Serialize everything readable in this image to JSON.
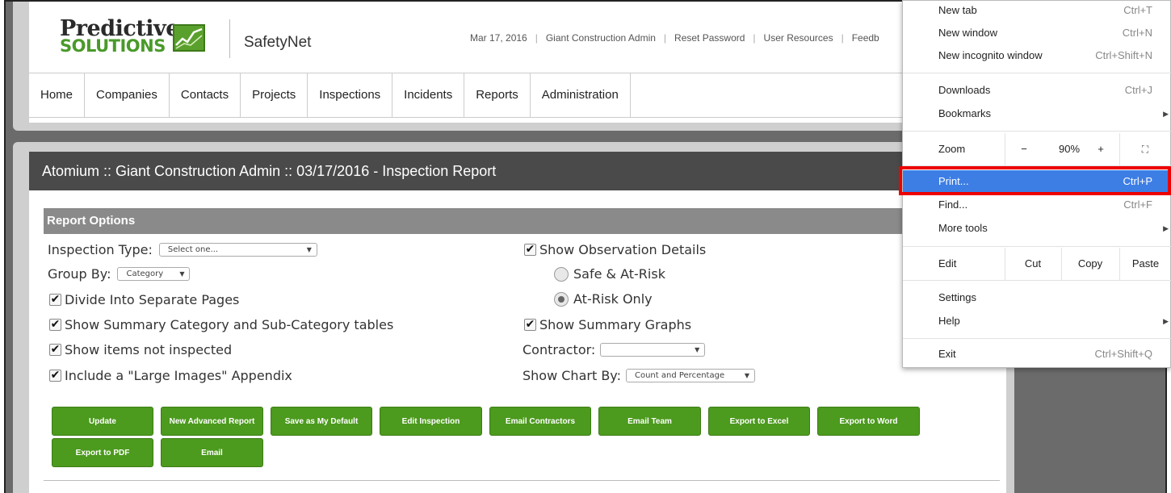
{
  "header": {
    "logo_line1": "Predictive",
    "logo_line2": "SOLUTIONS",
    "app_name": "SafetyNet",
    "links": [
      "Mar 17, 2016",
      "Giant Construction Admin",
      "Reset Password",
      "User Resources",
      "Feedb"
    ]
  },
  "nav": [
    "Home",
    "Companies",
    "Contacts",
    "Projects",
    "Inspections",
    "Incidents",
    "Reports",
    "Administration"
  ],
  "page": {
    "title": "Atomium :: Giant Construction Admin :: 03/17/2016 - Inspection Report",
    "options_header": "Report Options"
  },
  "options": {
    "inspection_type_label": "Inspection Type:",
    "inspection_type_value": "Select one...",
    "group_by_label": "Group By:",
    "group_by_value": "Category",
    "divide_pages": "Divide Into Separate Pages",
    "summary_tables": "Show Summary Category and Sub-Category tables",
    "not_inspected": "Show items not inspected",
    "large_images": "Include a \"Large Images\" Appendix",
    "observation_details": "Show Observation Details",
    "safe_at_risk": "Safe & At-Risk",
    "at_risk_only": "At-Risk Only",
    "summary_graphs": "Show Summary Graphs",
    "contractor_label": "Contractor:",
    "contractor_value": "",
    "chart_by_label": "Show Chart By:",
    "chart_by_value": "Count and Percentage"
  },
  "buttons": [
    "Update",
    "New Advanced Report",
    "Save as My Default",
    "Edit Inspection",
    "Email Contractors",
    "Email Team",
    "Export to Excel",
    "Export to Word",
    "Export to PDF",
    "Email"
  ],
  "menu": {
    "new_tab": "New tab",
    "new_tab_sc": "Ctrl+T",
    "new_window": "New window",
    "new_window_sc": "Ctrl+N",
    "incognito": "New incognito window",
    "incognito_sc": "Ctrl+Shift+N",
    "downloads": "Downloads",
    "downloads_sc": "Ctrl+J",
    "bookmarks": "Bookmarks",
    "zoom": "Zoom",
    "zoom_minus": "−",
    "zoom_value": "90%",
    "zoom_plus": "+",
    "print": "Print...",
    "print_sc": "Ctrl+P",
    "find": "Find...",
    "find_sc": "Ctrl+F",
    "more_tools": "More tools",
    "edit": "Edit",
    "cut": "Cut",
    "copy": "Copy",
    "paste": "Paste",
    "settings": "Settings",
    "help": "Help",
    "exit": "Exit",
    "exit_sc": "Ctrl+Shift+Q"
  }
}
